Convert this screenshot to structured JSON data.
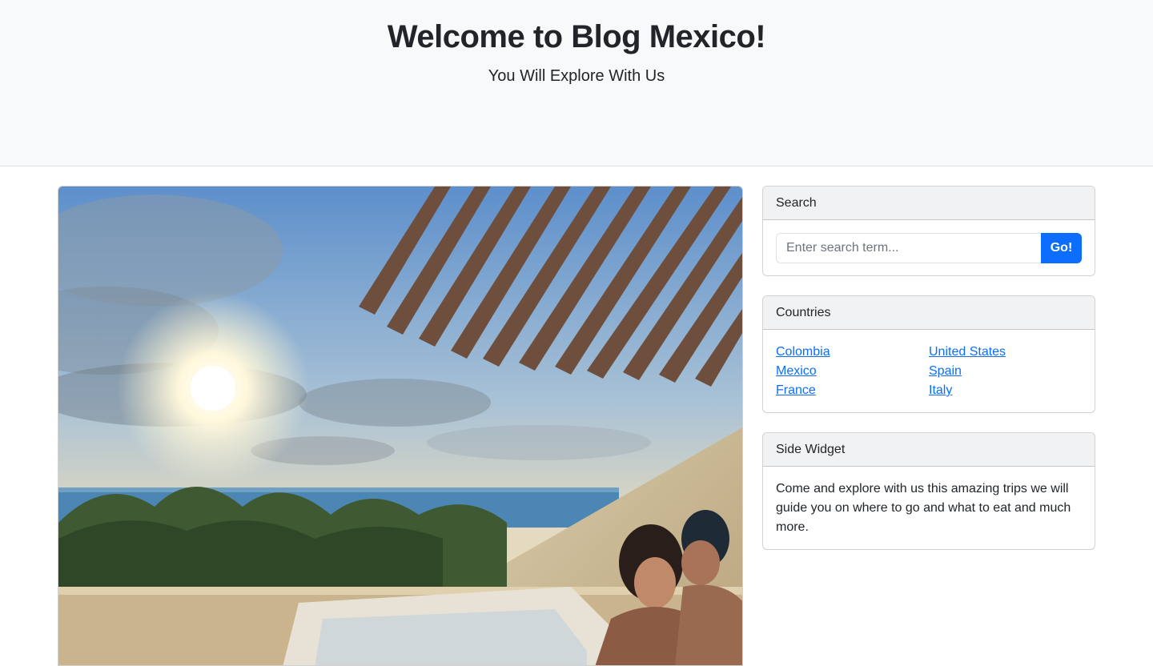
{
  "header": {
    "title": "Welcome to Blog Mexico!",
    "subtitle": "You Will Explore With Us"
  },
  "hero": {
    "image_name": "couple-in-rooftop-hot-tub-at-sunset"
  },
  "search": {
    "heading": "Search",
    "placeholder": "Enter search term...",
    "button_label": "Go!"
  },
  "countries": {
    "heading": "Countries",
    "left": [
      "Colombia",
      "Mexico",
      "France"
    ],
    "right": [
      "United States",
      "Spain",
      "Italy"
    ]
  },
  "side_widget": {
    "heading": "Side Widget",
    "text": "Come and explore with us this amazing trips we will guide you on where to go and what to eat and much more."
  },
  "colors": {
    "accent": "#0d6efd",
    "header_bg": "#f8f9fa"
  }
}
